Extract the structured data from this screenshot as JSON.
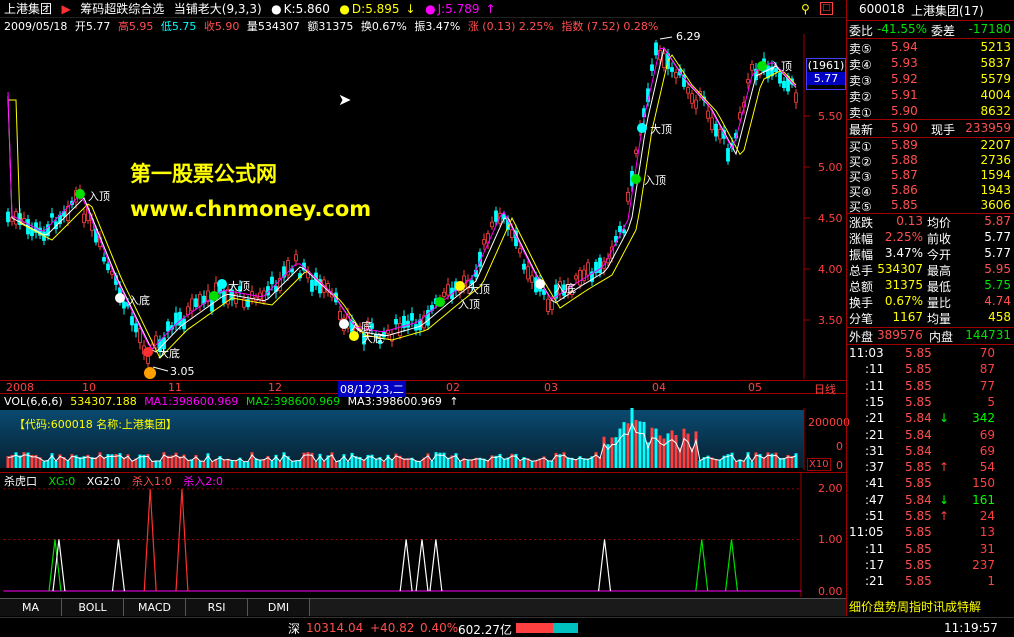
{
  "topbar": {
    "stock_name": "上港集团",
    "formula_name": "筹码超跌综合选",
    "author": "当铺老大(9,3,3)",
    "k_label": "K:5.860",
    "d_label": "D:5.895",
    "j_label": "J:5.789"
  },
  "infoline": {
    "date": "2009/05/18",
    "open": "开5.77",
    "high": "高5.95",
    "low": "低5.75",
    "close": "收5.90",
    "volume": "量534307",
    "amount": "额31375",
    "turnover": "换0.67%",
    "amplitude": "振3.47%",
    "change": "涨 (0.13) 2.25%",
    "index": "指数 (7.52) 0.28%"
  },
  "main_chart": {
    "price_axis": [
      "5.50",
      "5.00",
      "4.50",
      "4.00",
      "3.50"
    ],
    "high_label": "6.29",
    "low_label": "3.05",
    "current_box_top": "(1961)",
    "current_box_bottom": "5.77",
    "annotations": [
      {
        "text": "入顶"
      },
      {
        "text": "入底"
      },
      {
        "text": "大顶"
      },
      {
        "text": "大底"
      },
      {
        "text": "入底"
      },
      {
        "text": "大底"
      },
      {
        "text": "大顶"
      },
      {
        "text": "入顶"
      },
      {
        "text": "入底"
      },
      {
        "text": "入顶"
      },
      {
        "text": "大顶"
      },
      {
        "text": "入顶"
      }
    ],
    "watermark_title": "第一股票公式网",
    "watermark_url": "www.chnmoney.com"
  },
  "date_axis": {
    "labels": [
      "2008",
      "10",
      "11",
      "12",
      "08/12/23,二",
      "02",
      "03",
      "04",
      "05"
    ],
    "right": "日线"
  },
  "vol": {
    "header_name": "VOL(6,6,6)",
    "header_val": "534307.188",
    "ma1": "MA1:398600.969",
    "ma2": "MA2:398600.969",
    "ma3": "MA3:398600.969",
    "info_box": "【代码:600018  名称:上港集团】",
    "axis_top": "200000",
    "axis_mid": "0",
    "axis_bottom": "0",
    "x10": "X10"
  },
  "indicator": {
    "name": "杀虎口",
    "xg0": "XG:0",
    "xg2": "XG2:0",
    "sr1": "杀入1:0",
    "sr2": "杀入2:0",
    "axis": [
      "2.00",
      "1.00",
      "0.00"
    ]
  },
  "tabs": [
    "MA",
    "BOLL",
    "MACD",
    "RSI",
    "DMI"
  ],
  "status": {
    "market": "深",
    "index": "10314.04",
    "change": "+40.82",
    "pct": "0.40%",
    "amount": "602.27亿",
    "time": "11:19:57"
  },
  "right_panel": {
    "code": "600018",
    "name": "上港集团(17)",
    "weibi_label": "委比",
    "weibi_value": "-41.55%",
    "weicha_label": "委差",
    "weicha_value": "-17180",
    "sells": [
      {
        "label": "卖⑤",
        "price": "5.94",
        "vol": "5213"
      },
      {
        "label": "卖④",
        "price": "5.93",
        "vol": "5837"
      },
      {
        "label": "卖③",
        "price": "5.92",
        "vol": "5579"
      },
      {
        "label": "卖②",
        "price": "5.91",
        "vol": "4004"
      },
      {
        "label": "卖①",
        "price": "5.90",
        "vol": "8632"
      }
    ],
    "latest_label": "最新",
    "latest": "5.90",
    "xianshou_label": "现手",
    "xianshou": "233959",
    "buys": [
      {
        "label": "买①",
        "price": "5.89",
        "vol": "2207"
      },
      {
        "label": "买②",
        "price": "5.88",
        "vol": "2736"
      },
      {
        "label": "买③",
        "price": "5.87",
        "vol": "1594"
      },
      {
        "label": "买④",
        "price": "5.86",
        "vol": "1943"
      },
      {
        "label": "买⑤",
        "price": "5.85",
        "vol": "3606"
      }
    ],
    "stats": [
      {
        "l1": "涨跌",
        "v1": "0.13",
        "l2": "均价",
        "v2": "5.87"
      },
      {
        "l1": "涨幅",
        "v1": "2.25%",
        "l2": "前收",
        "v2": "5.77"
      },
      {
        "l1": "振幅",
        "v1": "3.47%",
        "l2": "今开",
        "v2": "5.77"
      },
      {
        "l1": "总手",
        "v1": "534307",
        "l2": "最高",
        "v2": "5.95"
      },
      {
        "l1": "总额",
        "v1": "31375",
        "l2": "最低",
        "v2": "5.75"
      },
      {
        "l1": "换手",
        "v1": "0.67%",
        "l2": "量比",
        "v2": "4.74"
      },
      {
        "l1": "分笔",
        "v1": "1167",
        "l2": "均量",
        "v2": "458"
      }
    ],
    "outer_label": "外盘",
    "outer": "389576",
    "inner_label": "内盘",
    "inner": "144731",
    "ticks": [
      {
        "t": "11:03",
        "p": "5.85",
        "v": "70",
        "a": ""
      },
      {
        "t": ":11",
        "p": "5.85",
        "v": "87",
        "a": ""
      },
      {
        "t": ":11",
        "p": "5.85",
        "v": "77",
        "a": ""
      },
      {
        "t": ":15",
        "p": "5.85",
        "v": "5",
        "a": ""
      },
      {
        "t": ":21",
        "p": "5.84",
        "v": "342",
        "a": "↓"
      },
      {
        "t": ":21",
        "p": "5.84",
        "v": "69",
        "a": ""
      },
      {
        "t": ":31",
        "p": "5.84",
        "v": "69",
        "a": ""
      },
      {
        "t": ":37",
        "p": "5.85",
        "v": "54",
        "a": "↑"
      },
      {
        "t": ":41",
        "p": "5.85",
        "v": "150",
        "a": ""
      },
      {
        "t": ":47",
        "p": "5.84",
        "v": "161",
        "a": "↓"
      },
      {
        "t": ":51",
        "p": "5.85",
        "v": "24",
        "a": "↑"
      },
      {
        "t": "11:05",
        "p": "5.85",
        "v": "13",
        "a": ""
      },
      {
        "t": ":11",
        "p": "5.85",
        "v": "31",
        "a": ""
      },
      {
        "t": ":17",
        "p": "5.85",
        "v": "237",
        "a": ""
      },
      {
        "t": ":21",
        "p": "5.85",
        "v": "1",
        "a": ""
      }
    ],
    "bottom_tabs": "细价盘势周指时讯成特解"
  }
}
